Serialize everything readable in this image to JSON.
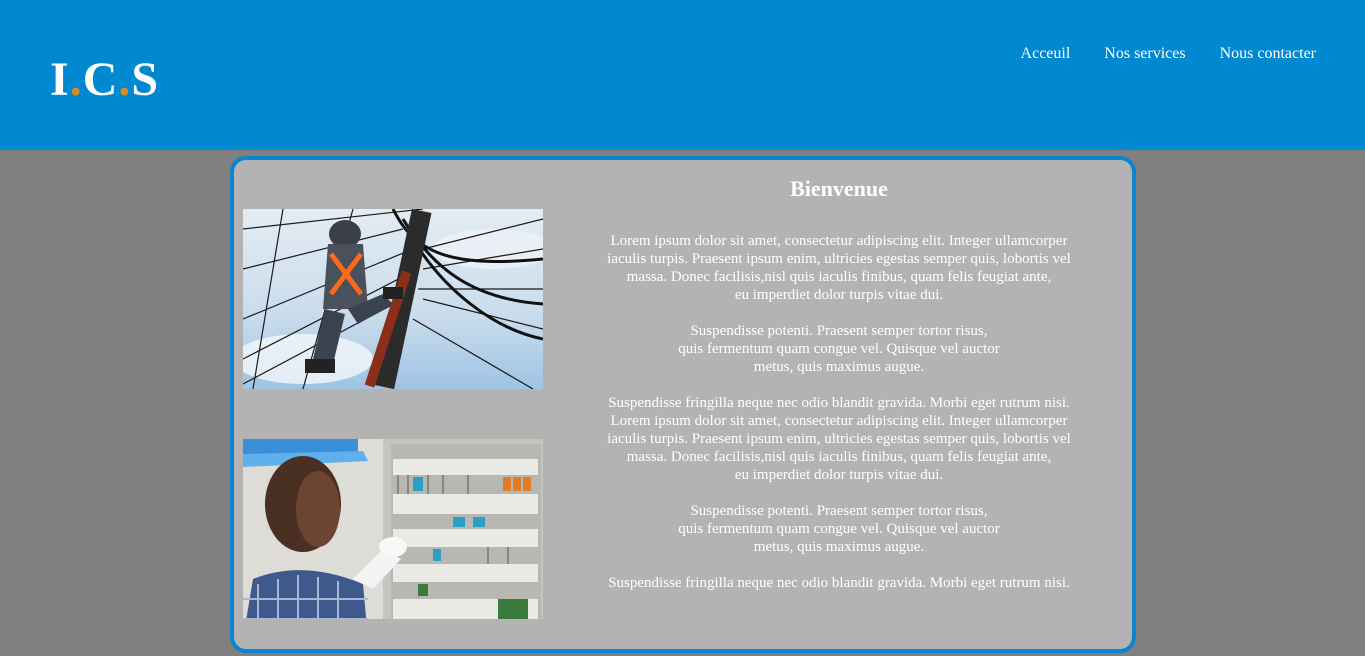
{
  "header": {
    "logo": {
      "letters": [
        "I",
        "C",
        "S"
      ],
      "separator": "."
    },
    "nav": [
      {
        "label": "Acceuil"
      },
      {
        "label": "Nos services"
      },
      {
        "label": "Nous contacter"
      }
    ]
  },
  "main": {
    "title": "Bienvenue",
    "paragraphs": [
      "Lorem ipsum dolor sit amet, consectetur adipiscing elit. Integer ullamcorper\niaculis turpis. Praesent ipsum enim, ultricies egestas semper quis, lobortis vel\nmassa. Donec facilisis,nisl quis iaculis finibus, quam felis feugiat ante,\neu imperdiet dolor turpis vitae dui.",
      "Suspendisse potenti. Praesent semper tortor risus,\nquis fermentum quam congue vel. Quisque vel auctor\nmetus, quis maximus augue.",
      "Suspendisse fringilla neque nec odio blandit gravida. Morbi eget rutrum nisi.\nLorem ipsum dolor sit amet, consectetur adipiscing elit. Integer ullamcorper\niaculis turpis. Praesent ipsum enim, ultricies egestas semper quis, lobortis vel\nmassa. Donec facilisis,nisl quis iaculis finibus, quam felis feugiat ante,\neu imperdiet dolor turpis vitae dui.",
      "Suspendisse potenti. Praesent semper tortor risus,\nquis fermentum quam congue vel. Quisque vel auctor\nmetus, quis maximus augue.",
      "Suspendisse fringilla neque nec odio blandit gravida. Morbi eget rutrum nisi."
    ],
    "images": [
      {
        "name": "electrician-on-pole-photo"
      },
      {
        "name": "electrician-at-panel-photo"
      }
    ]
  },
  "colors": {
    "header_bg": "#0088d1",
    "page_bg": "#808080",
    "card_bg": "#b3b3b3",
    "card_border": "#0a85cf",
    "logo_dot": "#e08a1e"
  }
}
